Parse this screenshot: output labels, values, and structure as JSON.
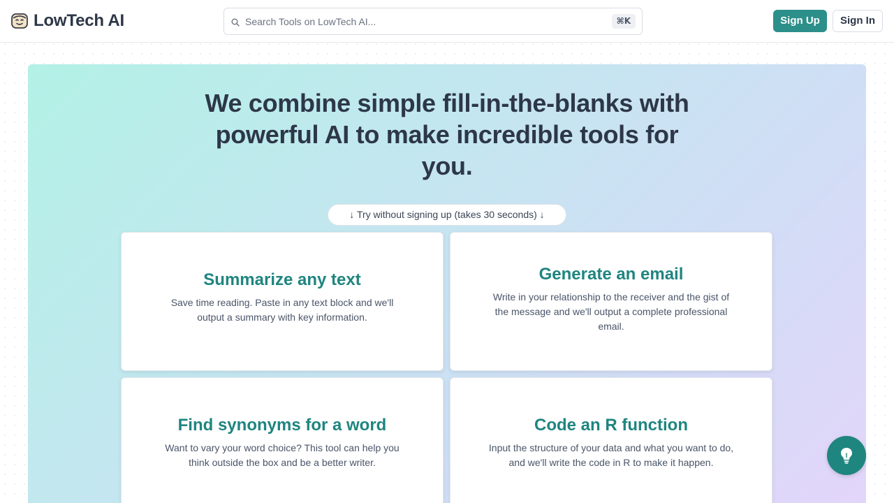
{
  "header": {
    "logo_text": "LowTech AI",
    "logo_icon": "robot-face-icon",
    "search": {
      "placeholder": "Search Tools on LowTech AI...",
      "value": "",
      "shortcut": "⌘K"
    },
    "signup_label": "Sign Up",
    "signin_label": "Sign In"
  },
  "hero": {
    "title": "We combine simple fill-in-the-blanks with powerful AI to make incredible tools for you.",
    "try_label": "↓ Try without signing up (takes 30 seconds) ↓"
  },
  "tools": [
    {
      "title": "Summarize any text",
      "description": "Save time reading. Paste in any text block and we'll output a summary with key information."
    },
    {
      "title": "Generate an email",
      "description": "Write in your relationship to the receiver and the gist of the message and we'll output a complete professional email."
    },
    {
      "title": "Find synonyms for a word",
      "description": "Want to vary your word choice? This tool can help you think outside the box and be a better writer."
    },
    {
      "title": "Code an R function",
      "description": "Input the structure of your data and what you want to do, and we'll write the code in R to make it happen."
    }
  ],
  "fab": {
    "icon": "lightbulb-icon"
  },
  "colors": {
    "accent": "#2c8f8a",
    "card_title": "#1f857f",
    "text": "#2d3748"
  }
}
